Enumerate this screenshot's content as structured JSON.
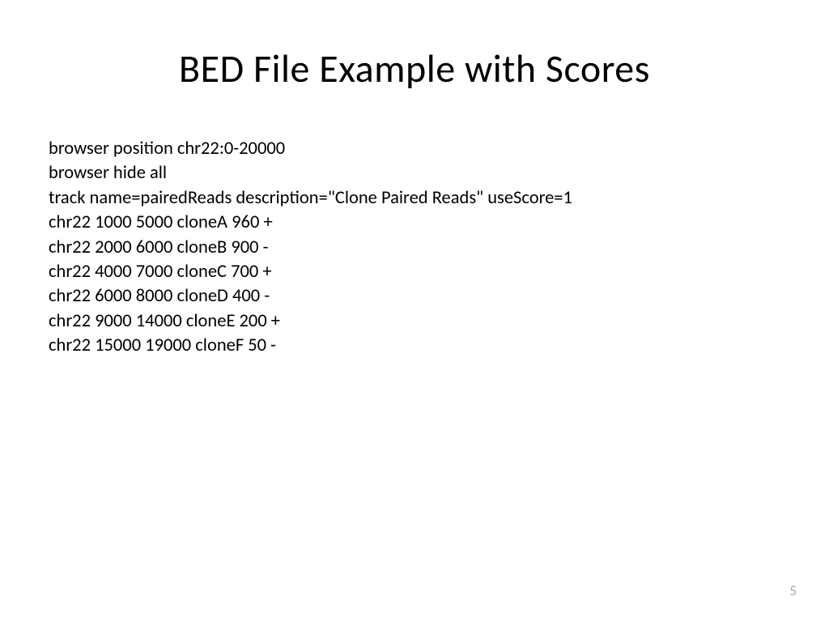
{
  "title": "BED File Example with Scores",
  "lines": [
    "browser position chr22:0-20000",
    "browser hide all",
    "track name=pairedReads description=\"Clone Paired Reads\" useScore=1",
    "chr22 1000 5000 cloneA 960 +",
    "chr22 2000 6000 cloneB 900 -",
    "chr22 4000 7000 cloneC 700 +",
    "chr22 6000 8000 cloneD 400 -",
    "chr22 9000 14000 cloneE 200 +",
    "chr22 15000 19000 cloneF 50 -"
  ],
  "pageNumber": "5"
}
